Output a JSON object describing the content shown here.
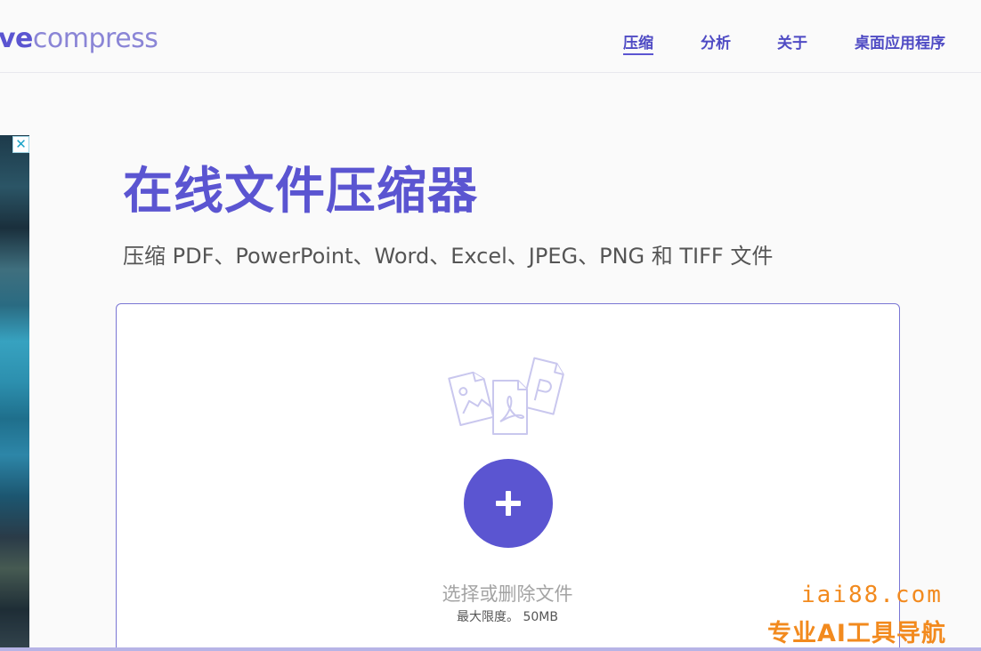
{
  "header": {
    "logo_prefix": "ve",
    "logo_rest": "compress",
    "nav": [
      {
        "label": "压缩",
        "active": true
      },
      {
        "label": "分析",
        "active": false
      },
      {
        "label": "关于",
        "active": false
      },
      {
        "label": "桌面应用程序",
        "active": false
      }
    ]
  },
  "ad": {
    "close_glyph": "✕"
  },
  "hero": {
    "title": "在线文件压缩器",
    "subtitle": "压缩 PDF、PowerPoint、Word、Excel、JPEG、PNG 和 TIFF 文件"
  },
  "upload": {
    "illustration_icon": "files-illustration-icon",
    "add_icon": "plus-icon",
    "select_label": "选择或删除文件",
    "limit_label": "最大限度。 50MB"
  },
  "watermark": {
    "url": "iai88.com",
    "text": "专业AI工具导航"
  },
  "colors": {
    "accent": "#5b55d1",
    "logo_light": "#8a85d6",
    "watermark": "#f28a1e"
  }
}
